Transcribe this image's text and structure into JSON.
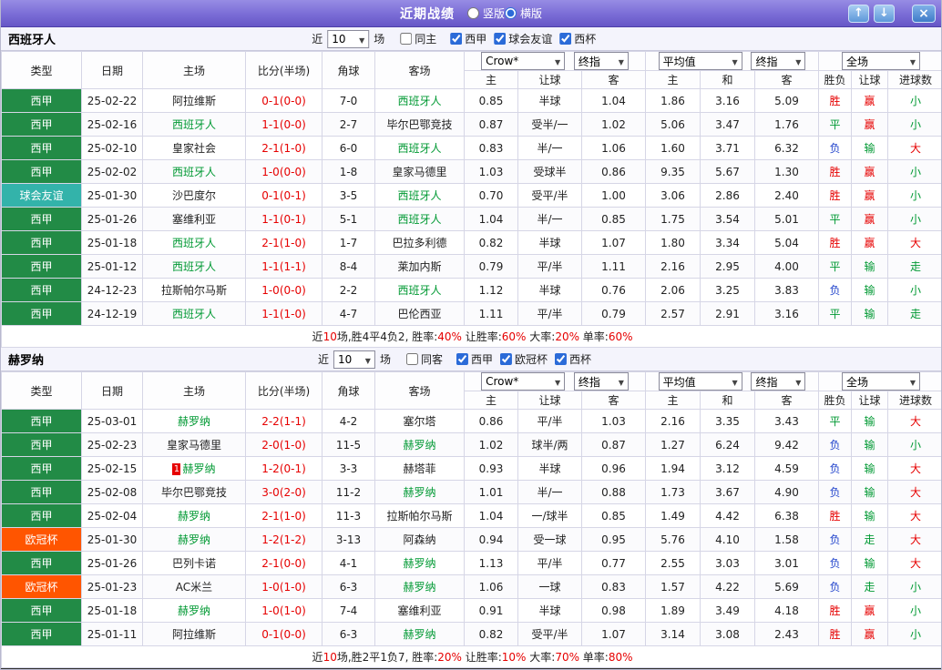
{
  "topbar": {
    "title": "近期战绩",
    "radios": [
      {
        "label": "竖版",
        "selected": false
      },
      {
        "label": "横版",
        "selected": true
      }
    ],
    "buttons": {
      "up": "↑",
      "down": "↓",
      "close": "×"
    }
  },
  "filter_labels": {
    "near": "近",
    "games": "场"
  },
  "headers": {
    "type": "类型",
    "date": "日期",
    "home": "主场",
    "score": "比分(半场)",
    "corner": "角球",
    "away": "客场",
    "asia_select": "Crow*",
    "asia_final": "终指",
    "euro_select": "平均值",
    "euro_final": "终指",
    "full_select": "全场",
    "asia_cols": [
      "主",
      "让球",
      "客"
    ],
    "euro_cols": [
      "主",
      "和",
      "客"
    ],
    "result_cols": [
      "胜负",
      "让球",
      "进球数"
    ]
  },
  "type_colors": {
    "西甲": "#228B46",
    "球会友谊": "#33B3AA",
    "欧冠杯": "#FF5500"
  },
  "sections": [
    {
      "team": "西班牙人",
      "filter": {
        "count": "10",
        "same": {
          "label": "同主",
          "checked": false
        },
        "leagues": [
          {
            "label": "西甲",
            "checked": true
          },
          {
            "label": "球会友谊",
            "checked": true
          },
          {
            "label": "西杯",
            "checked": true
          }
        ]
      },
      "rows": [
        {
          "t": "西甲",
          "d": "25-02-22",
          "h": "阿拉维斯",
          "hf": false,
          "s": "0-1(0-0)",
          "c": "7-0",
          "a": "西班牙人",
          "af": true,
          "ao": [
            "0.85",
            "半球",
            "1.04"
          ],
          "eo": [
            "1.86",
            "3.16",
            "5.09"
          ],
          "r": [
            [
              "胜",
              "red"
            ],
            [
              "赢",
              "red"
            ],
            [
              "小",
              "green"
            ]
          ]
        },
        {
          "t": "西甲",
          "d": "25-02-16",
          "h": "西班牙人",
          "hf": true,
          "s": "1-1(0-0)",
          "c": "2-7",
          "a": "毕尔巴鄂竞技",
          "af": false,
          "ao": [
            "0.87",
            "受半/一",
            "1.02"
          ],
          "eo": [
            "5.06",
            "3.47",
            "1.76"
          ],
          "r": [
            [
              "平",
              "green"
            ],
            [
              "赢",
              "red"
            ],
            [
              "小",
              "green"
            ]
          ]
        },
        {
          "t": "西甲",
          "d": "25-02-10",
          "h": "皇家社会",
          "hf": false,
          "s": "2-1(1-0)",
          "c": "6-0",
          "a": "西班牙人",
          "af": true,
          "ao": [
            "0.83",
            "半/一",
            "1.06"
          ],
          "eo": [
            "1.60",
            "3.71",
            "6.32"
          ],
          "r": [
            [
              "负",
              "blue"
            ],
            [
              "输",
              "green"
            ],
            [
              "大",
              "red"
            ]
          ]
        },
        {
          "t": "西甲",
          "d": "25-02-02",
          "h": "西班牙人",
          "hf": true,
          "s": "1-0(0-0)",
          "c": "1-8",
          "a": "皇家马德里",
          "af": false,
          "ao": [
            "1.03",
            "受球半",
            "0.86"
          ],
          "eo": [
            "9.35",
            "5.67",
            "1.30"
          ],
          "r": [
            [
              "胜",
              "red"
            ],
            [
              "赢",
              "red"
            ],
            [
              "小",
              "green"
            ]
          ]
        },
        {
          "t": "球会友谊",
          "d": "25-01-30",
          "h": "沙巴度尔",
          "hf": false,
          "s": "0-1(0-1)",
          "c": "3-5",
          "a": "西班牙人",
          "af": true,
          "ao": [
            "0.70",
            "受平/半",
            "1.00"
          ],
          "eo": [
            "3.06",
            "2.86",
            "2.40"
          ],
          "r": [
            [
              "胜",
              "red"
            ],
            [
              "赢",
              "red"
            ],
            [
              "小",
              "green"
            ]
          ]
        },
        {
          "t": "西甲",
          "d": "25-01-26",
          "h": "塞维利亚",
          "hf": false,
          "s": "1-1(0-1)",
          "c": "5-1",
          "a": "西班牙人",
          "af": true,
          "ao": [
            "1.04",
            "半/一",
            "0.85"
          ],
          "eo": [
            "1.75",
            "3.54",
            "5.01"
          ],
          "r": [
            [
              "平",
              "green"
            ],
            [
              "赢",
              "red"
            ],
            [
              "小",
              "green"
            ]
          ]
        },
        {
          "t": "西甲",
          "d": "25-01-18",
          "h": "西班牙人",
          "hf": true,
          "s": "2-1(1-0)",
          "c": "1-7",
          "a": "巴拉多利德",
          "af": false,
          "ao": [
            "0.82",
            "半球",
            "1.07"
          ],
          "eo": [
            "1.80",
            "3.34",
            "5.04"
          ],
          "r": [
            [
              "胜",
              "red"
            ],
            [
              "赢",
              "red"
            ],
            [
              "大",
              "red"
            ]
          ]
        },
        {
          "t": "西甲",
          "d": "25-01-12",
          "h": "西班牙人",
          "hf": true,
          "s": "1-1(1-1)",
          "c": "8-4",
          "a": "莱加内斯",
          "af": false,
          "ao": [
            "0.79",
            "平/半",
            "1.11"
          ],
          "eo": [
            "2.16",
            "2.95",
            "4.00"
          ],
          "r": [
            [
              "平",
              "green"
            ],
            [
              "输",
              "green"
            ],
            [
              "走",
              "green"
            ]
          ]
        },
        {
          "t": "西甲",
          "d": "24-12-23",
          "h": "拉斯帕尔马斯",
          "hf": false,
          "s": "1-0(0-0)",
          "c": "2-2",
          "a": "西班牙人",
          "af": true,
          "ao": [
            "1.12",
            "半球",
            "0.76"
          ],
          "eo": [
            "2.06",
            "3.25",
            "3.83"
          ],
          "r": [
            [
              "负",
              "blue"
            ],
            [
              "输",
              "green"
            ],
            [
              "小",
              "green"
            ]
          ]
        },
        {
          "t": "西甲",
          "d": "24-12-19",
          "h": "西班牙人",
          "hf": true,
          "s": "1-1(1-0)",
          "c": "4-7",
          "a": "巴伦西亚",
          "af": false,
          "ao": [
            "1.11",
            "平/半",
            "0.79"
          ],
          "eo": [
            "2.57",
            "2.91",
            "3.16"
          ],
          "r": [
            [
              "平",
              "green"
            ],
            [
              "输",
              "green"
            ],
            [
              "走",
              "green"
            ]
          ]
        }
      ],
      "summary": [
        {
          "t": "近",
          "c": "k"
        },
        {
          "t": "10",
          "c": "r"
        },
        {
          "t": "场,胜4平4负2, 胜率:",
          "c": "k"
        },
        {
          "t": "40%",
          "c": "r"
        },
        {
          "t": " 让胜率:",
          "c": "k"
        },
        {
          "t": "60%",
          "c": "r"
        },
        {
          "t": " 大率:",
          "c": "k"
        },
        {
          "t": "20%",
          "c": "r"
        },
        {
          "t": " 单率:",
          "c": "k"
        },
        {
          "t": "60%",
          "c": "r"
        }
      ]
    },
    {
      "team": "赫罗纳",
      "filter": {
        "count": "10",
        "same": {
          "label": "同客",
          "checked": false
        },
        "leagues": [
          {
            "label": "西甲",
            "checked": true
          },
          {
            "label": "欧冠杯",
            "checked": true
          },
          {
            "label": "西杯",
            "checked": true
          }
        ]
      },
      "rows": [
        {
          "t": "西甲",
          "d": "25-03-01",
          "h": "赫罗纳",
          "hf": true,
          "s": "2-2(1-1)",
          "c": "4-2",
          "a": "塞尔塔",
          "af": false,
          "ao": [
            "0.86",
            "平/半",
            "1.03"
          ],
          "eo": [
            "2.16",
            "3.35",
            "3.43"
          ],
          "r": [
            [
              "平",
              "green"
            ],
            [
              "输",
              "green"
            ],
            [
              "大",
              "red"
            ]
          ]
        },
        {
          "t": "西甲",
          "d": "25-02-23",
          "h": "皇家马德里",
          "hf": false,
          "s": "2-0(1-0)",
          "c": "11-5",
          "a": "赫罗纳",
          "af": true,
          "ao": [
            "1.02",
            "球半/两",
            "0.87"
          ],
          "eo": [
            "1.27",
            "6.24",
            "9.42"
          ],
          "r": [
            [
              "负",
              "blue"
            ],
            [
              "输",
              "green"
            ],
            [
              "小",
              "green"
            ]
          ]
        },
        {
          "t": "西甲",
          "d": "25-02-15",
          "h": "赫罗纳",
          "hf": true,
          "hb": "1",
          "s": "1-2(0-1)",
          "c": "3-3",
          "a": "赫塔菲",
          "af": false,
          "ao": [
            "0.93",
            "半球",
            "0.96"
          ],
          "eo": [
            "1.94",
            "3.12",
            "4.59"
          ],
          "r": [
            [
              "负",
              "blue"
            ],
            [
              "输",
              "green"
            ],
            [
              "大",
              "red"
            ]
          ]
        },
        {
          "t": "西甲",
          "d": "25-02-08",
          "h": "毕尔巴鄂竞技",
          "hf": false,
          "s": "3-0(2-0)",
          "c": "11-2",
          "a": "赫罗纳",
          "af": true,
          "ao": [
            "1.01",
            "半/一",
            "0.88"
          ],
          "eo": [
            "1.73",
            "3.67",
            "4.90"
          ],
          "r": [
            [
              "负",
              "blue"
            ],
            [
              "输",
              "green"
            ],
            [
              "大",
              "red"
            ]
          ]
        },
        {
          "t": "西甲",
          "d": "25-02-04",
          "h": "赫罗纳",
          "hf": true,
          "s": "2-1(1-0)",
          "c": "11-3",
          "a": "拉斯帕尔马斯",
          "af": false,
          "ao": [
            "1.04",
            "一/球半",
            "0.85"
          ],
          "eo": [
            "1.49",
            "4.42",
            "6.38"
          ],
          "r": [
            [
              "胜",
              "red"
            ],
            [
              "输",
              "green"
            ],
            [
              "大",
              "red"
            ]
          ]
        },
        {
          "t": "欧冠杯",
          "d": "25-01-30",
          "h": "赫罗纳",
          "hf": true,
          "s": "1-2(1-2)",
          "c": "3-13",
          "a": "阿森纳",
          "af": false,
          "ao": [
            "0.94",
            "受一球",
            "0.95"
          ],
          "eo": [
            "5.76",
            "4.10",
            "1.58"
          ],
          "r": [
            [
              "负",
              "blue"
            ],
            [
              "走",
              "green"
            ],
            [
              "大",
              "red"
            ]
          ]
        },
        {
          "t": "西甲",
          "d": "25-01-26",
          "h": "巴列卡诺",
          "hf": false,
          "s": "2-1(0-0)",
          "c": "4-1",
          "a": "赫罗纳",
          "af": true,
          "ao": [
            "1.13",
            "平/半",
            "0.77"
          ],
          "eo": [
            "2.55",
            "3.03",
            "3.01"
          ],
          "r": [
            [
              "负",
              "blue"
            ],
            [
              "输",
              "green"
            ],
            [
              "大",
              "red"
            ]
          ]
        },
        {
          "t": "欧冠杯",
          "d": "25-01-23",
          "h": "AC米兰",
          "hf": false,
          "s": "1-0(1-0)",
          "c": "6-3",
          "a": "赫罗纳",
          "af": true,
          "ao": [
            "1.06",
            "一球",
            "0.83"
          ],
          "eo": [
            "1.57",
            "4.22",
            "5.69"
          ],
          "r": [
            [
              "负",
              "blue"
            ],
            [
              "走",
              "green"
            ],
            [
              "小",
              "green"
            ]
          ]
        },
        {
          "t": "西甲",
          "d": "25-01-18",
          "h": "赫罗纳",
          "hf": true,
          "s": "1-0(1-0)",
          "c": "7-4",
          "a": "塞维利亚",
          "af": false,
          "ao": [
            "0.91",
            "半球",
            "0.98"
          ],
          "eo": [
            "1.89",
            "3.49",
            "4.18"
          ],
          "r": [
            [
              "胜",
              "red"
            ],
            [
              "赢",
              "red"
            ],
            [
              "小",
              "green"
            ]
          ]
        },
        {
          "t": "西甲",
          "d": "25-01-11",
          "h": "阿拉维斯",
          "hf": false,
          "s": "0-1(0-0)",
          "c": "6-3",
          "a": "赫罗纳",
          "af": true,
          "ao": [
            "0.82",
            "受平/半",
            "1.07"
          ],
          "eo": [
            "3.14",
            "3.08",
            "2.43"
          ],
          "r": [
            [
              "胜",
              "red"
            ],
            [
              "赢",
              "red"
            ],
            [
              "小",
              "green"
            ]
          ]
        }
      ],
      "summary": [
        {
          "t": "近",
          "c": "k"
        },
        {
          "t": "10",
          "c": "r"
        },
        {
          "t": "场,胜2平1负7, 胜率:",
          "c": "k"
        },
        {
          "t": "20%",
          "c": "r"
        },
        {
          "t": " 让胜率:",
          "c": "k"
        },
        {
          "t": "10%",
          "c": "r"
        },
        {
          "t": " 大率:",
          "c": "k"
        },
        {
          "t": "70%",
          "c": "r"
        },
        {
          "t": " 单率:",
          "c": "k"
        },
        {
          "t": "80%",
          "c": "r"
        }
      ]
    }
  ]
}
